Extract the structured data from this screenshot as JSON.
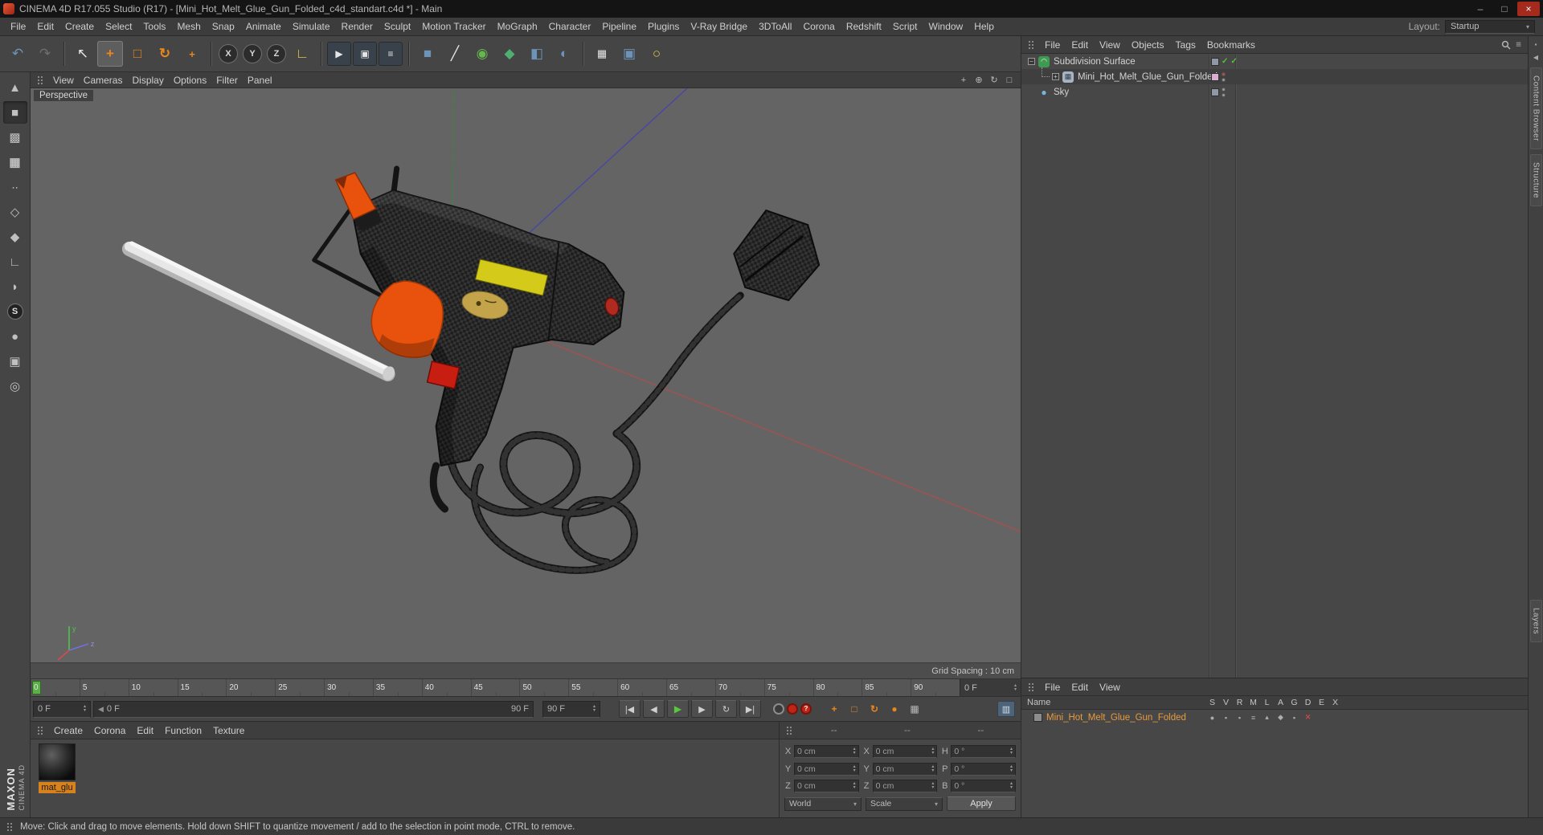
{
  "window": {
    "title": "CINEMA 4D R17.055 Studio (R17) - [Mini_Hot_Melt_Glue_Gun_Folded_c4d_standart.c4d *] - Main",
    "minimize": "–",
    "maximize": "□",
    "close": "×"
  },
  "menubar": {
    "items": [
      "File",
      "Edit",
      "Create",
      "Select",
      "Tools",
      "Mesh",
      "Snap",
      "Animate",
      "Simulate",
      "Render",
      "Sculpt",
      "Motion Tracker",
      "MoGraph",
      "Character",
      "Pipeline",
      "Plugins",
      "V-Ray Bridge",
      "3DToAll",
      "Corona",
      "Redshift",
      "Script",
      "Window",
      "Help"
    ],
    "layout_label": "Layout:",
    "layout_value": "Startup"
  },
  "toolbar": {
    "undo": "↶",
    "redo": "↷",
    "live_selection": "↖",
    "move": "+",
    "scale": "□",
    "rotate": "↻",
    "last_tool": "+",
    "axis_x": "X",
    "axis_y": "Y",
    "axis_z": "Z",
    "coord_system": "∟",
    "render_view": "▶",
    "render_picture_viewer": "▣",
    "render_settings": "≡",
    "cube": "■",
    "pen": "╱",
    "spline": "◉",
    "mograph": "◆",
    "deformer": "◧",
    "floor": "◐",
    "array": "▦",
    "camera": "▣",
    "light": "○"
  },
  "left_palette": {
    "items": [
      {
        "name": "make-editable",
        "glyph": "▲"
      },
      {
        "name": "model-mode",
        "glyph": "■"
      },
      {
        "name": "texture-mode",
        "glyph": "▩"
      },
      {
        "name": "workplane-mode",
        "glyph": "▦"
      },
      {
        "name": "points-mode",
        "glyph": "∙∙"
      },
      {
        "name": "edges-mode",
        "glyph": "◇"
      },
      {
        "name": "polygons-mode",
        "glyph": "◆"
      },
      {
        "name": "axis-mode",
        "glyph": "∟"
      },
      {
        "name": "tweak-mode",
        "glyph": "◗"
      },
      {
        "name": "snap-mode",
        "glyph": "S"
      },
      {
        "name": "paint-mode",
        "glyph": "●"
      },
      {
        "name": "lock-workplane",
        "glyph": "▣"
      },
      {
        "name": "planar-workplane",
        "glyph": "◎"
      }
    ]
  },
  "viewport": {
    "menu": [
      "View",
      "Cameras",
      "Display",
      "Options",
      "Filter",
      "Panel"
    ],
    "label": "Perspective",
    "grid_spacing": "Grid Spacing : 10 cm",
    "axis": {
      "x": "x",
      "y": "y",
      "z": "z"
    },
    "nav_icons": {
      "pan": "+",
      "zoom": "⊕",
      "rotate": "↻",
      "toggle": "□"
    }
  },
  "timeline": {
    "ticks": [
      "0",
      "5",
      "10",
      "15",
      "20",
      "25",
      "30",
      "35",
      "40",
      "45",
      "50",
      "55",
      "60",
      "65",
      "70",
      "75",
      "80",
      "85",
      "90"
    ],
    "ruler_frame": "0 F",
    "frame": "0 F",
    "range_start": "0 F",
    "range_end": "90 F",
    "end": "90 F",
    "transport": {
      "go_start": "|◀",
      "prev": "◀",
      "play": "▶",
      "next": "▶",
      "loop": "↻",
      "go_end": "▶|"
    },
    "key_question": "?",
    "key_icons": {
      "position": "+",
      "scale": "□",
      "rotation": "↻",
      "parameter": "●",
      "pla": "▦",
      "options": "▥"
    }
  },
  "materials": {
    "menu": [
      "Create",
      "Corona",
      "Edit",
      "Function",
      "Texture"
    ],
    "material_name": "mat_glu"
  },
  "coordinates": {
    "headers": [
      "--",
      "--",
      "--"
    ],
    "rows": [
      {
        "a": "X",
        "av": "0 cm",
        "b": "X",
        "bv": "0 cm",
        "c": "H",
        "cv": "0 °"
      },
      {
        "a": "Y",
        "av": "0 cm",
        "b": "Y",
        "bv": "0 cm",
        "c": "P",
        "cv": "0 °"
      },
      {
        "a": "Z",
        "av": "0 cm",
        "b": "Z",
        "bv": "0 cm",
        "c": "B",
        "cv": "0 °"
      }
    ],
    "mode_position": "World",
    "mode_size": "Scale",
    "apply": "Apply"
  },
  "object_manager": {
    "menu": [
      "File",
      "Edit",
      "View",
      "Objects",
      "Tags",
      "Bookmarks"
    ],
    "icons": {
      "subdivision": "◠",
      "mesh": "▦",
      "sky": "●"
    },
    "objects": [
      {
        "label": "Subdivision Surface"
      },
      {
        "label": "Mini_Hot_Melt_Glue_Gun_Folded"
      },
      {
        "label": "Sky"
      }
    ],
    "enabled_check": "✓"
  },
  "layer_browser": {
    "menu": [
      "File",
      "Edit",
      "View"
    ],
    "name_header": "Name",
    "columns": [
      "S",
      "V",
      "R",
      "M",
      "L",
      "A",
      "G",
      "D",
      "E",
      "X"
    ],
    "item": "Mini_Hot_Melt_Glue_Gun_Folded",
    "toggles": [
      "●",
      "▪",
      "▪",
      "≡",
      "▴",
      "◆",
      "▪",
      "✕"
    ]
  },
  "right_strip": {
    "icons": [
      {
        "name": "dock-pin-icon",
        "glyph": "▪"
      },
      {
        "name": "dock-collapse-icon",
        "glyph": "◀"
      }
    ],
    "tabs": [
      "Content Browser",
      "Structure",
      "Layers"
    ]
  },
  "statusbar": {
    "text": "Move: Click and drag to move elements. Hold down SHIFT to quantize movement / add to the selection in point mode, CTRL to remove."
  },
  "colors": {
    "accent_orange": "#e8871e",
    "selection_orange": "#e89a3c",
    "viewport_gray": "#646464",
    "axis_red": "#a85050",
    "axis_green": "#4a7a4a",
    "axis_blue": "#4646a8",
    "play_green": "#5ac83c",
    "material_label_bg": "#d8821e"
  }
}
